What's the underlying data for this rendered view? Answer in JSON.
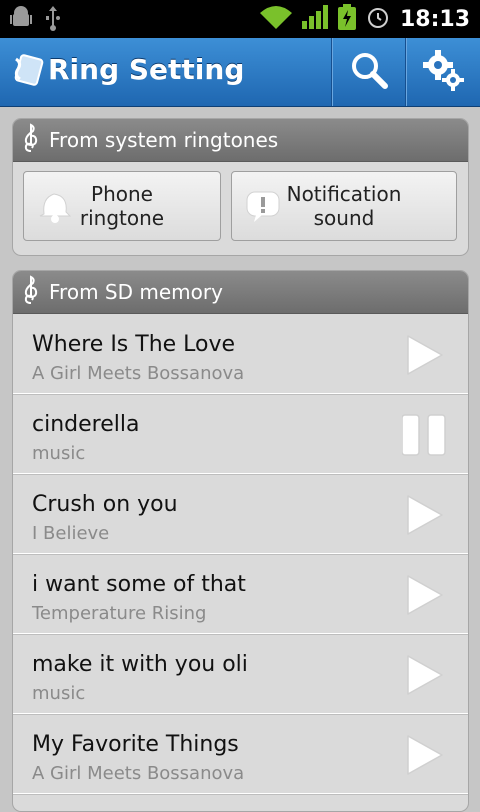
{
  "status": {
    "time": "18:13"
  },
  "app": {
    "title": "Ring Setting"
  },
  "system_section": {
    "header": "From system ringtones",
    "buttons": [
      {
        "label_line1": "Phone",
        "label_line2": "ringtone",
        "icon": "bell-icon"
      },
      {
        "label_line1": "Notification",
        "label_line2": "sound",
        "icon": "notification-icon"
      }
    ]
  },
  "sd_section": {
    "header": "From SD memory",
    "tracks": [
      {
        "title": "Where Is The Love",
        "album": "A Girl Meets Bossanova",
        "state": "play"
      },
      {
        "title": "cinderella",
        "album": "music",
        "state": "pause"
      },
      {
        "title": "Crush on you",
        "album": "I Believe",
        "state": "play"
      },
      {
        "title": "i want some of that",
        "album": "Temperature Rising",
        "state": "play"
      },
      {
        "title": "make it with you oli",
        "album": "music",
        "state": "play"
      },
      {
        "title": "My Favorite Things",
        "album": "A Girl Meets Bossanova",
        "state": "play"
      }
    ]
  }
}
